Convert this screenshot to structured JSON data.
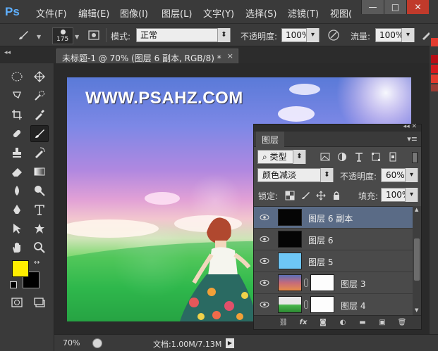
{
  "app": {
    "logo": "Ps",
    "menu": [
      "文件(F)",
      "编辑(E)",
      "图像(I)",
      "图层(L)",
      "文字(Y)",
      "选择(S)",
      "滤镜(T)",
      "视图("
    ],
    "window_controls": [
      "—",
      "□",
      "✕"
    ]
  },
  "options_bar": {
    "brush_size": "175",
    "mode_label": "模式:",
    "mode_value": "正常",
    "opacity_label": "不透明度:",
    "opacity_value": "100%",
    "flow_label": "流量:",
    "flow_value": "100%"
  },
  "document": {
    "tab_title": "未标题-1 @ 70% (图层 6 副本, RGB/8) *",
    "close_glyph": "×",
    "watermark": "WWW.PSAHZ.COM"
  },
  "status_bar": {
    "zoom": "70%",
    "doc_size": "文档:1.00M/7.13M"
  },
  "colors": {
    "foreground": "#ffee00",
    "background": "#000000",
    "selected_layer": "#5a6b86"
  },
  "layers_panel": {
    "tab": "图层",
    "filter_label": "类型",
    "blend_mode": "颜色减淡",
    "opacity_label": "不透明度:",
    "opacity_value": "60%",
    "lock_label": "锁定:",
    "fill_label": "填充:",
    "fill_value": "100%",
    "layers": [
      {
        "name": "图层 6 副本",
        "thumb": "black",
        "mask": false,
        "selected": true
      },
      {
        "name": "图层 6",
        "thumb": "black",
        "mask": false,
        "selected": false
      },
      {
        "name": "图层 5",
        "thumb": "sky",
        "mask": false,
        "selected": false
      },
      {
        "name": "图层 3",
        "thumb": "sunset",
        "mask": true,
        "selected": false
      },
      {
        "name": "图层 4",
        "thumb": "transparent-grass",
        "mask": true,
        "selected": false
      }
    ],
    "footer_icons": [
      "link-icon",
      "fx-icon",
      "add-mask-icon",
      "adjustment-icon",
      "group-folder-icon",
      "new-layer-icon",
      "trash-icon"
    ]
  }
}
